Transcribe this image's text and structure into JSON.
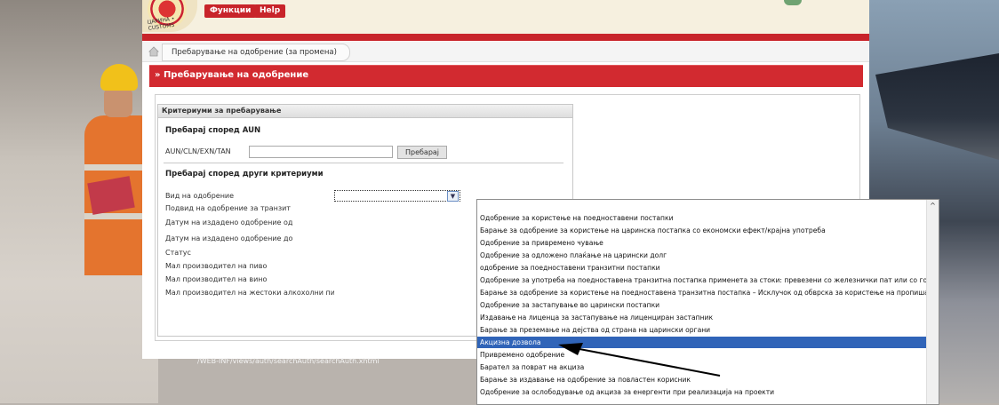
{
  "header": {
    "logo_text": "ЦАРИНА • CUSTOMS",
    "buttons": [
      "Функции",
      "Help"
    ]
  },
  "breadcrumb": {
    "item": "Пребарување на одобрение (за промена)"
  },
  "page_title": "» Пребарување на одобрение",
  "panel": {
    "title": "Критериуми за пребарување",
    "section_aun": "Пребарај според AUN",
    "aun_label": "AUN/CLN/EXN/TAN",
    "aun_value": "",
    "search_button": "Пребарај",
    "section_other": "Пребарај според други критериуми",
    "criteria": [
      "Вид на одобрение",
      "Подвид на одобрение за транзит",
      "Датум на издадено одобрение од",
      "Датум на издадено одобрение до",
      "Статус",
      "Мал производител на пиво",
      "Мал производител на вино",
      "Мал производител на жестоки алкохолни пијалаци"
    ]
  },
  "footer_path": "/WEB-INF/views/auth/searchAuth/searchAuth.xhtml",
  "dropdown": {
    "items": [
      "",
      "Одобрение за користење на поедноставени постапки",
      "Барање за одобрение за користење на царинска постапка со економски ефект/крајна употреба",
      "Одобрение за привремено чување",
      "Одобрение за одложено плаќање на царински долг",
      "одобрение за поедноставени транзитни постапки",
      "Одобрение за употреба на поедноставена транзитна постапка применета за стоки: превезени со железнички пат или со големи контејнери",
      "Барање за одобрение за користење на поедноставена транзитна постапка – Исклучок од обврска за користење на пропишан возен ред",
      "Одобрение за застапување во царински постапки",
      "Издавање на лиценца за застапување на лиценциран застапник",
      "Барање за преземање на дејства од страна на царински органи",
      "Акцизна дозвола",
      "Привремено одобрение",
      "Барател за поврат на акциза",
      "Барање за издавање на одобрение за повластен корисник",
      "Одобрение за ослободување од акциза за енергенти при реализација на проекти"
    ],
    "selected_index": 11
  },
  "colors": {
    "brand_red": "#d22a30",
    "selection_blue": "#3064b8"
  }
}
